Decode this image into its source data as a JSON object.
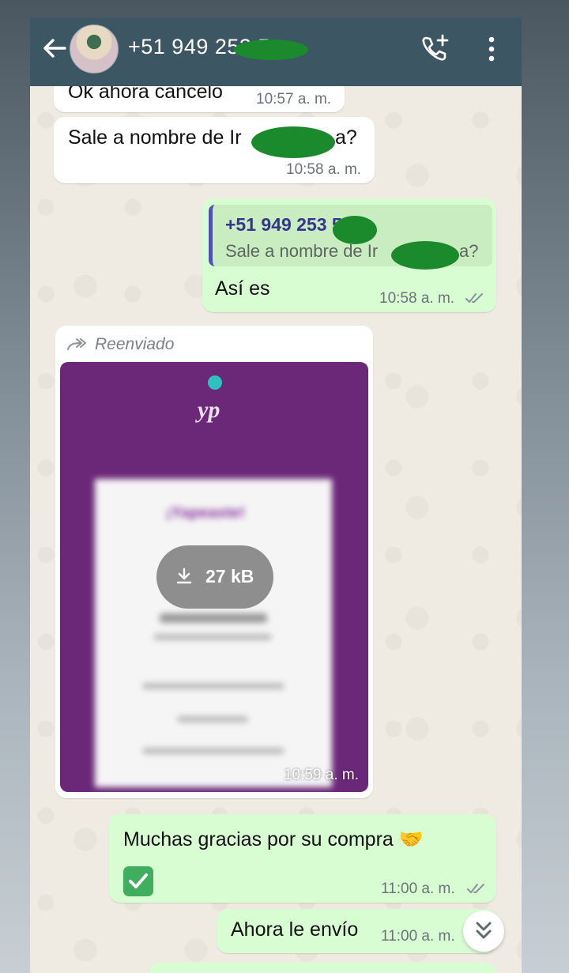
{
  "header": {
    "contact_name": "+51 949 253 5",
    "icons": {
      "back": "arrow-left-icon",
      "avatar": "contact-avatar",
      "add_call": "phone-add-icon",
      "menu": "more-vertical-icon"
    }
  },
  "messages": [
    {
      "type": "incoming",
      "text": "Ok ahora cancelo",
      "time": "10:57 a. m."
    },
    {
      "type": "incoming",
      "text": "Sale a nombre de Ir",
      "text_end": "a?",
      "time": "10:58 a. m."
    },
    {
      "type": "outgoing",
      "quote_name": "+51 949 253 5",
      "quote_text": "Sale a nombre de Ir",
      "quote_text_end": "a?",
      "text": "Así es",
      "time": "10:58 a. m."
    },
    {
      "type": "incoming-media",
      "forwarded_label": "Reenviado",
      "media_logo": "yape",
      "receipt_title": "¡Yapeaste!",
      "download_size": "27 kB",
      "time": "10:59 a. m."
    },
    {
      "type": "outgoing",
      "text": "Muchas gracias por su compra 🤝",
      "emoji_check": "✓",
      "time": "11:00 a. m."
    },
    {
      "type": "outgoing",
      "text": "Ahora le envío",
      "time": "11:00 a. m."
    }
  ],
  "colors": {
    "header": "#3d5663",
    "outgoing": "#d9fdd3",
    "incoming": "#ffffff",
    "wallpaper": "#efeae2",
    "media_bg": "#6b2878",
    "quote_bar": "#4f51b6"
  },
  "scroll_button_icon": "double-chevron-down-icon"
}
